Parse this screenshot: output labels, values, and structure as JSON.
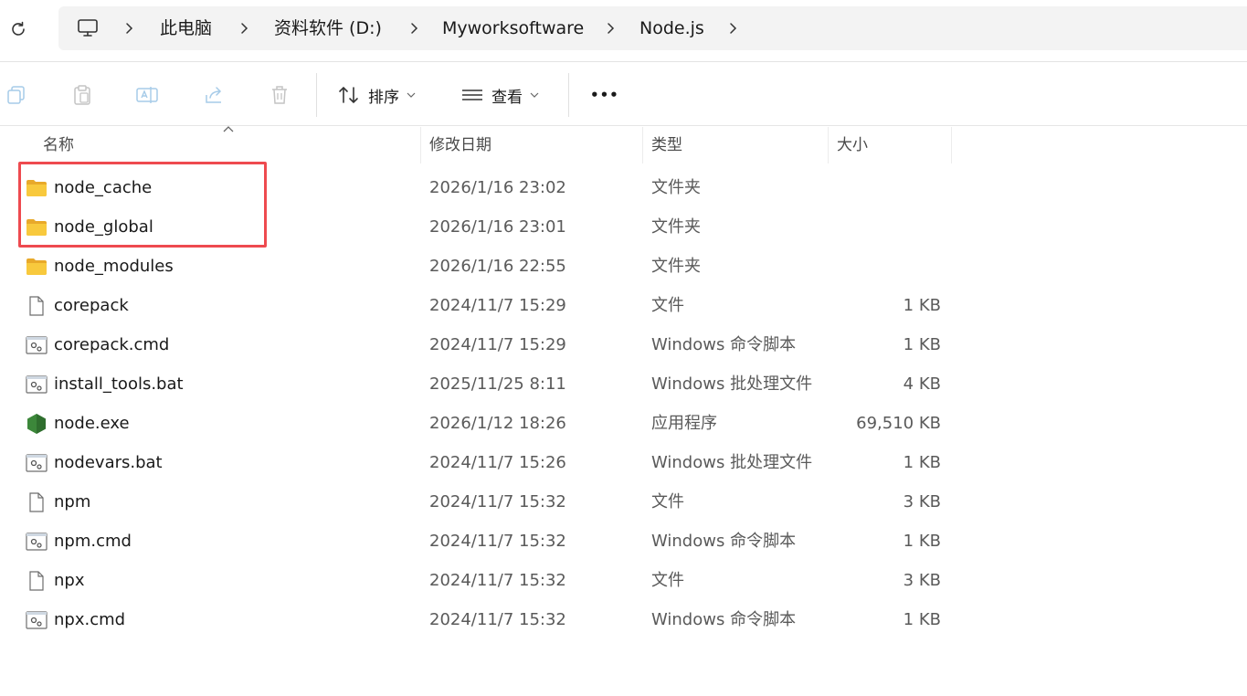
{
  "breadcrumb": {
    "items": [
      "此电脑",
      "资料软件 (D:)",
      "Myworksoftware",
      "Node.js"
    ]
  },
  "toolbar": {
    "sort_label": "排序",
    "view_label": "查看",
    "more_label": "•••"
  },
  "columns": {
    "name": "名称",
    "date": "修改日期",
    "type": "类型",
    "size": "大小"
  },
  "files": [
    {
      "name": "node_cache",
      "date": "2026/1/16 23:02",
      "type": "文件夹",
      "size": "",
      "icon": "folder-icon"
    },
    {
      "name": "node_global",
      "date": "2026/1/16 23:01",
      "type": "文件夹",
      "size": "",
      "icon": "folder-icon"
    },
    {
      "name": "node_modules",
      "date": "2026/1/16 22:55",
      "type": "文件夹",
      "size": "",
      "icon": "folder-icon"
    },
    {
      "name": "corepack",
      "date": "2024/11/7 15:29",
      "type": "文件",
      "size": "1 KB",
      "icon": "file-icon"
    },
    {
      "name": "corepack.cmd",
      "date": "2024/11/7 15:29",
      "type": "Windows 命令脚本",
      "size": "1 KB",
      "icon": "script-icon"
    },
    {
      "name": "install_tools.bat",
      "date": "2025/11/25 8:11",
      "type": "Windows 批处理文件",
      "size": "4 KB",
      "icon": "script-icon"
    },
    {
      "name": "node.exe",
      "date": "2026/1/12 18:26",
      "type": "应用程序",
      "size": "69,510 KB",
      "icon": "nodejs-icon"
    },
    {
      "name": "nodevars.bat",
      "date": "2024/11/7 15:26",
      "type": "Windows 批处理文件",
      "size": "1 KB",
      "icon": "script-icon"
    },
    {
      "name": "npm",
      "date": "2024/11/7 15:32",
      "type": "文件",
      "size": "3 KB",
      "icon": "file-icon"
    },
    {
      "name": "npm.cmd",
      "date": "2024/11/7 15:32",
      "type": "Windows 命令脚本",
      "size": "1 KB",
      "icon": "script-icon"
    },
    {
      "name": "npx",
      "date": "2024/11/7 15:32",
      "type": "文件",
      "size": "3 KB",
      "icon": "file-icon"
    },
    {
      "name": "npx.cmd",
      "date": "2024/11/7 15:32",
      "type": "Windows 命令脚本",
      "size": "1 KB",
      "icon": "script-icon"
    }
  ],
  "colors": {
    "highlight": "#ee4a4f",
    "folder": "#f8c93d",
    "nodejs": "#3c873a"
  }
}
